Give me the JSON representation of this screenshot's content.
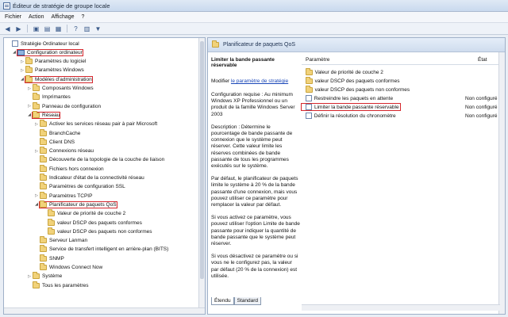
{
  "window": {
    "title": "Éditeur de stratégie de groupe locale"
  },
  "menu": [
    "Fichier",
    "Action",
    "Affichage",
    "?"
  ],
  "toolbar": {
    "icons": [
      "back-icon",
      "forward-icon",
      "up-folder-icon",
      "show-hide-tree-icon",
      "export-icon",
      "help-icon",
      "filter-icon"
    ]
  },
  "tree": [
    {
      "label": "Stratégie Ordinateur local",
      "level": 0,
      "icon": "policy",
      "toggle": ""
    },
    {
      "label": "Configuration ordinateur",
      "level": 1,
      "icon": "pc",
      "toggle": "▲",
      "highlight": true
    },
    {
      "label": "Paramètres du logiciel",
      "level": 2,
      "icon": "folder",
      "toggle": "▷"
    },
    {
      "label": "Paramètres Windows",
      "level": 2,
      "icon": "folder",
      "toggle": "▷"
    },
    {
      "label": "Modèles d'administration",
      "level": 2,
      "icon": "folder",
      "toggle": "▲",
      "highlight": true
    },
    {
      "label": "Composants Windows",
      "level": 3,
      "icon": "folder",
      "toggle": "▷"
    },
    {
      "label": "Imprimantes",
      "level": 3,
      "icon": "folder",
      "toggle": ""
    },
    {
      "label": "Panneau de configuration",
      "level": 3,
      "icon": "folder",
      "toggle": "▷"
    },
    {
      "label": "Réseau",
      "level": 3,
      "icon": "folder",
      "toggle": "▲",
      "highlight": true
    },
    {
      "label": "Activer les services réseau pair à pair Microsoft",
      "level": 4,
      "icon": "folder",
      "toggle": "▷"
    },
    {
      "label": "BranchCache",
      "level": 4,
      "icon": "folder",
      "toggle": ""
    },
    {
      "label": "Client DNS",
      "level": 4,
      "icon": "folder",
      "toggle": ""
    },
    {
      "label": "Connexions réseau",
      "level": 4,
      "icon": "folder",
      "toggle": "▷"
    },
    {
      "label": "Découverte de la topologie de la couche de liaison",
      "level": 4,
      "icon": "folder",
      "toggle": ""
    },
    {
      "label": "Fichiers hors connexion",
      "level": 4,
      "icon": "folder",
      "toggle": ""
    },
    {
      "label": "Indicateur d'état de la connectivité réseau",
      "level": 4,
      "icon": "folder",
      "toggle": ""
    },
    {
      "label": "Paramètres de configuration SSL",
      "level": 4,
      "icon": "folder",
      "toggle": ""
    },
    {
      "label": "Paramètres TCPIP",
      "level": 4,
      "icon": "folder",
      "toggle": "▷"
    },
    {
      "label": "Planificateur de paquets QoS",
      "level": 4,
      "icon": "folder",
      "toggle": "▲",
      "highlight": true
    },
    {
      "label": "Valeur de priorité de couche 2",
      "level": 5,
      "icon": "folder",
      "toggle": ""
    },
    {
      "label": "valeur DSCP des paquets conformes",
      "level": 5,
      "icon": "folder",
      "toggle": ""
    },
    {
      "label": "valeur DSCP des paquets non conformes",
      "level": 5,
      "icon": "folder",
      "toggle": ""
    },
    {
      "label": "Serveur Lanman",
      "level": 4,
      "icon": "folder",
      "toggle": ""
    },
    {
      "label": "Service de transfert intelligent en arrière-plan (BITS)",
      "level": 4,
      "icon": "folder",
      "toggle": ""
    },
    {
      "label": "SNMP",
      "level": 4,
      "icon": "folder",
      "toggle": ""
    },
    {
      "label": "Windows Connect Now",
      "level": 4,
      "icon": "folder",
      "toggle": ""
    },
    {
      "label": "Système",
      "level": 3,
      "icon": "folder",
      "toggle": "▷"
    },
    {
      "label": "Tous les paramètres",
      "level": 3,
      "icon": "folder",
      "toggle": ""
    }
  ],
  "right": {
    "header": "Planificateur de paquets QoS",
    "desc_title": "Limiter la bande passante réservable",
    "edit_prefix": "Modifier",
    "edit_link": "le paramètre de stratégie",
    "paragraphs": [
      "Configuration requise : Au minimum Windows XP Professionnel ou un produit de la famille Windows Server 2003",
      "Description : Détermine le pourcentage de bande passante de connexion que le système peut réserver. Cette valeur limite les réserves combinées de bande passante de tous les programmes exécutés sur le système.",
      "Par défaut, le planificateur de paquets limite le système à 20 % de la bande passante d'une connexion, mais vous pouvez utiliser ce paramètre pour remplacer la valeur par défaut.",
      "Si vous activez ce paramètre, vous pouvez utiliser l'option Limite de bande passante pour indiquer la quantité de bande passante que le système peut réserver.",
      "Si vous désactivez ce paramètre ou si vous ne le configurez pas, la valeur par défaut (20 % de la connexion) est utilisée."
    ],
    "columns": {
      "name": "Paramètre",
      "state": "État"
    },
    "rows": [
      {
        "icon": "folder",
        "name": "Valeur de priorité de couche 2",
        "state": ""
      },
      {
        "icon": "folder",
        "name": "valeur DSCP des paquets conformes",
        "state": ""
      },
      {
        "icon": "folder",
        "name": "valeur DSCP des paquets non conformes",
        "state": ""
      },
      {
        "icon": "policy",
        "name": "Restreindre les paquets en attente",
        "state": "Non configuré"
      },
      {
        "icon": "policy",
        "name": "Limiter la bande passante réservable",
        "state": "Non configuré",
        "highlight": true
      },
      {
        "icon": "policy",
        "name": "Définir la résolution du chronomètre",
        "state": "Non configuré"
      }
    ],
    "tabs": [
      "Étendu",
      "Standard"
    ]
  },
  "colors": {
    "highlight": "#d4262c",
    "link": "#1a47b8",
    "folder": "#f1d27a"
  }
}
